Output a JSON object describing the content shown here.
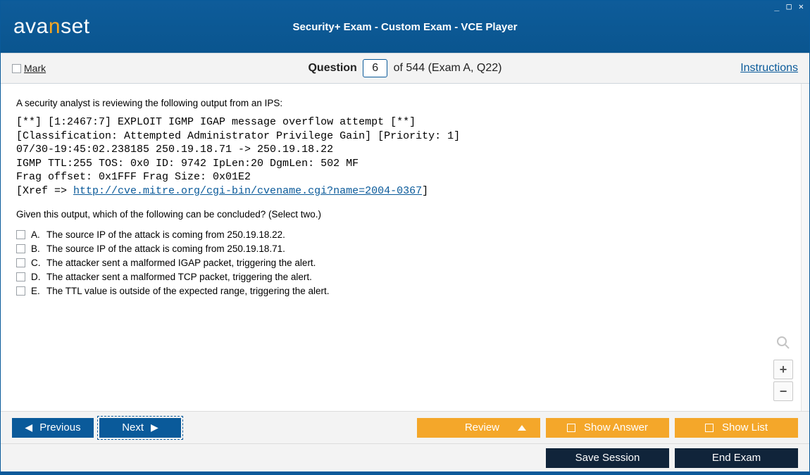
{
  "window": {
    "brand_prefix": "ava",
    "brand_accent": "n",
    "brand_suffix": "set",
    "title": "Security+ Exam - Custom Exam - VCE Player"
  },
  "qbar": {
    "mark_label": "Mark",
    "question_label": "Question",
    "question_number": "6",
    "of_text": "of 544 (Exam A, Q22)",
    "instructions_label": "Instructions"
  },
  "question": {
    "intro": "A security analyst is reviewing the following output from an IPS:",
    "ips_line1": "[**] [1:2467:7] EXPLOIT IGMP IGAP message overflow attempt [**]",
    "ips_line2": "[Classification: Attempted Administrator Privilege Gain] [Priority: 1]",
    "ips_line3": "07/30-19:45:02.238185 250.19.18.71 -> 250.19.18.22",
    "ips_line4": "IGMP TTL:255 TOS: 0x0 ID: 9742 IpLen:20 DgmLen: 502 MF",
    "ips_line5": "Frag offset: 0x1FFF Frag Size: 0x01E2",
    "ips_xref_prefix": "[Xref => ",
    "ips_xref_link": "http://cve.mitre.org/cgi-bin/cvename.cgi?name=2004-0367",
    "ips_xref_suffix": "]",
    "followup": "Given this output, which of the following can be concluded? (Select two.)",
    "answers": [
      {
        "letter": "A.",
        "text": "The source IP of the attack is coming from 250.19.18.22."
      },
      {
        "letter": "B.",
        "text": "The source IP of the attack is coming from 250.19.18.71."
      },
      {
        "letter": "C.",
        "text": "The attacker sent a malformed IGAP packet, triggering the alert."
      },
      {
        "letter": "D.",
        "text": "The attacker sent a malformed TCP packet, triggering the alert."
      },
      {
        "letter": "E.",
        "text": "The TTL value is outside of the expected range, triggering the alert."
      }
    ]
  },
  "zoom": {
    "plus": "+",
    "minus": "−"
  },
  "footer": {
    "previous": "Previous",
    "next": "Next",
    "review": "Review",
    "show_answer": "Show Answer",
    "show_list": "Show List",
    "save_session": "Save Session",
    "end_exam": "End Exam"
  }
}
